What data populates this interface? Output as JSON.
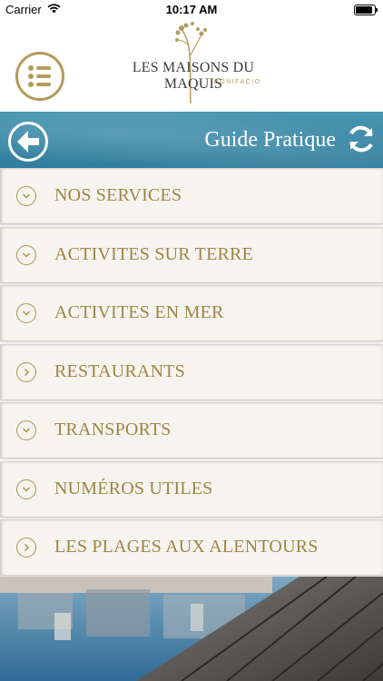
{
  "status_bar": {
    "carrier": "Carrier",
    "time": "10:17 AM"
  },
  "logo": {
    "name": "LES MAISONS DU MAQUIS",
    "location": "BONIFACIO"
  },
  "title_bar": {
    "title": "Guide Pratique"
  },
  "menu": [
    {
      "label": "NOS SERVICES",
      "icon": "chevron-down-icon"
    },
    {
      "label": "ACTIVITES SUR TERRE",
      "icon": "chevron-down-icon"
    },
    {
      "label": "ACTIVITES EN MER",
      "icon": "chevron-down-icon"
    },
    {
      "label": "RESTAURANTS",
      "icon": "chevron-right-icon"
    },
    {
      "label": "TRANSPORTS",
      "icon": "chevron-down-icon"
    },
    {
      "label": "NUMÉROS UTILES",
      "icon": "chevron-down-icon"
    },
    {
      "label": "LES PLAGES AUX ALENTOURS",
      "icon": "chevron-right-icon"
    }
  ],
  "colors": {
    "gold": "#9c8646",
    "blue": "#3a88a6",
    "item_bg": "#f7f4ef"
  }
}
